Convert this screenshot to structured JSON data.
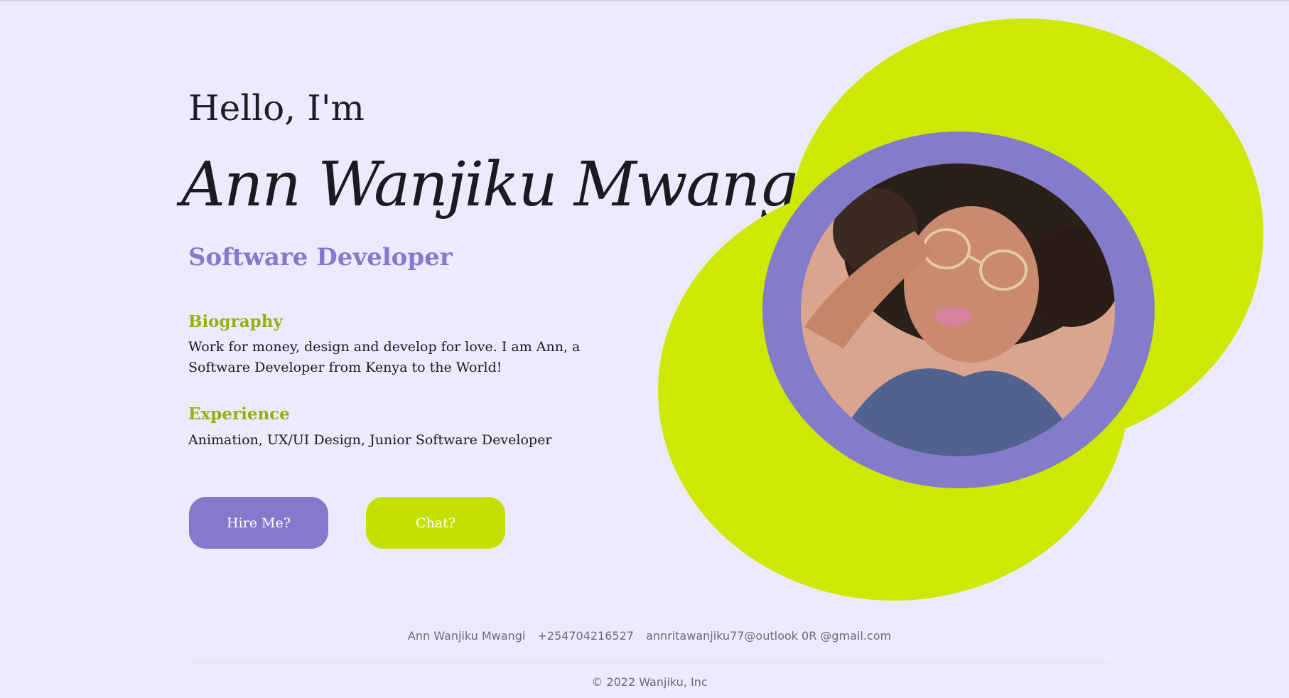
{
  "hero": {
    "greeting": "Hello, I'm",
    "name": "Ann Wanjiku Mwangi",
    "role": "Software Developer"
  },
  "biography": {
    "title": "Biography",
    "text": "Work for money, design and develop for love. I am Ann, a Software Developer from Kenya to the World!"
  },
  "experience": {
    "title": "Experience",
    "text": "Animation, UX/UI Design, Junior Software Developer"
  },
  "buttons": {
    "hire_label": "Hire Me?",
    "chat_label": "Chat?"
  },
  "footer": {
    "name": "Ann Wanjiku Mwangi",
    "phone": "+254704216527",
    "email": "annritawanjiku77@outlook 0R @gmail.com",
    "copyright": "© 2022 Wanjiku, Inc"
  },
  "colors": {
    "background": "#ecebfd",
    "accent_purple": "#8479cb",
    "accent_lime": "#cee703",
    "section_title": "#9aae10"
  }
}
